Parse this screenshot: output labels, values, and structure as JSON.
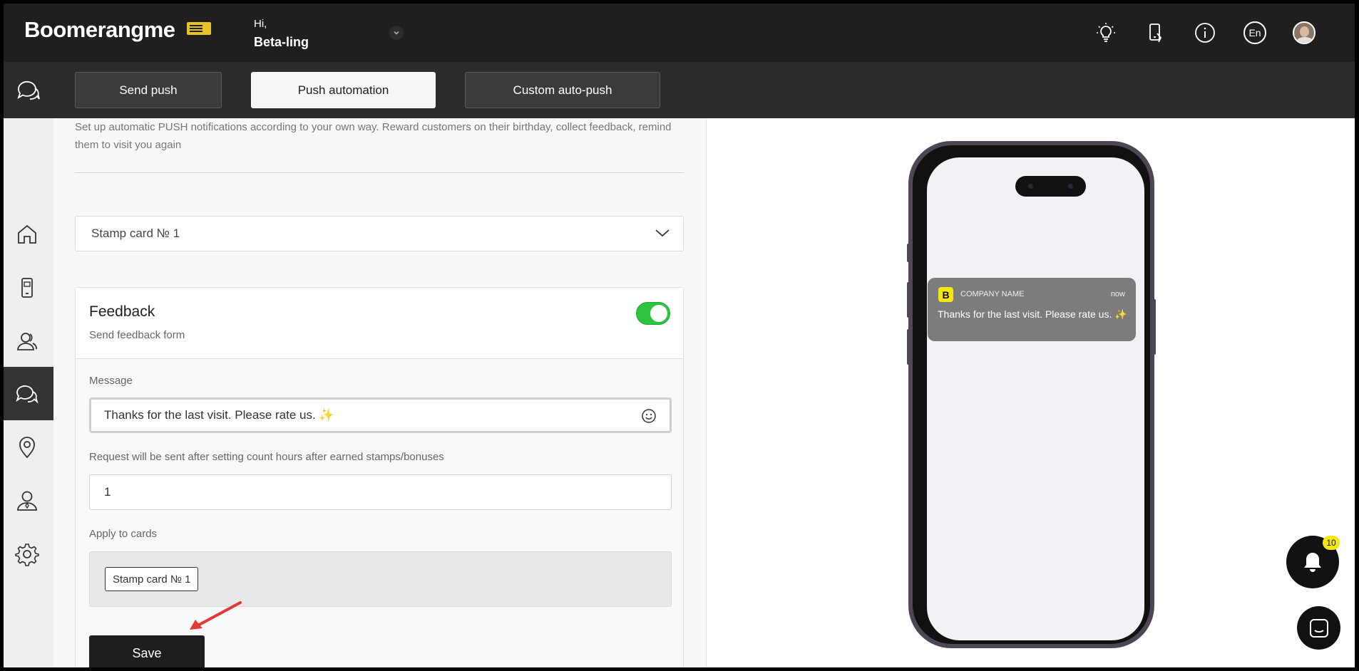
{
  "header": {
    "brand": "Boomerangme",
    "greeting_hi": "Hi,",
    "user_name": "Beta-ling",
    "language": "En"
  },
  "tabs": [
    {
      "label": "Send push"
    },
    {
      "label": "Push automation"
    },
    {
      "label": "Custom auto-push"
    }
  ],
  "sidebar": {
    "items": [
      {
        "icon": "home-icon"
      },
      {
        "icon": "mobile-card-icon"
      },
      {
        "icon": "clients-icon"
      },
      {
        "icon": "chat-icon"
      },
      {
        "icon": "location-icon"
      },
      {
        "icon": "manager-icon"
      },
      {
        "icon": "gear-icon"
      }
    ]
  },
  "main": {
    "intro": "Set up automatic PUSH notifications according to your own way. Reward customers on their birthday, collect feedback, remind them to visit you again",
    "card_select_value": "Stamp card № 1",
    "panel": {
      "title": "Feedback",
      "subtitle": "Send feedback form",
      "toggle_on": true,
      "message_label": "Message",
      "message_value": "Thanks for the last visit. Please rate us. ✨",
      "hours_label": "Request will be sent after setting count hours after earned stamps/bonuses",
      "hours_value": "1",
      "apply_label": "Apply to cards",
      "apply_chip": "Stamp card № 1",
      "save_label": "Save"
    }
  },
  "preview": {
    "logo_letter": "B",
    "company": "COMPANY NAME",
    "time": "now",
    "text": "Thanks for the last visit. Please rate us. ✨"
  },
  "notifications": {
    "count": "10"
  },
  "colors": {
    "toggle_on": "#2ec340",
    "badge": "#f5e70f",
    "annotation_arrow": "#e53935"
  }
}
